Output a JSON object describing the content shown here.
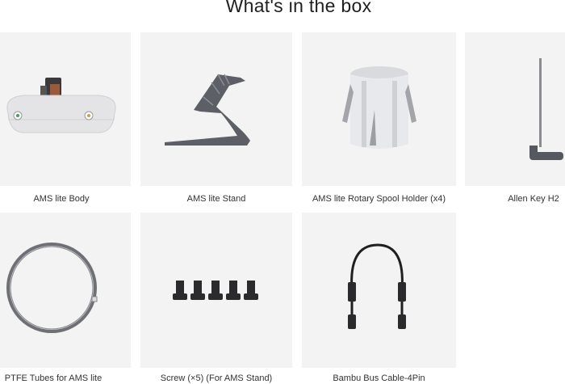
{
  "page": {
    "title": "What's in the box"
  },
  "items": [
    {
      "label": "AMS lite Body",
      "icon": "ams-lite-body-icon"
    },
    {
      "label": "AMS lite Stand",
      "icon": "ams-lite-stand-icon"
    },
    {
      "label": "AMS lite Rotary Spool Holder (x4)",
      "icon": "spool-holder-icon"
    },
    {
      "label": "Allen Key H2",
      "icon": "allen-key-icon"
    },
    {
      "label": "PTFE Tubes for AMS lite",
      "icon": "ptfe-tube-icon"
    },
    {
      "label": "Screw (×5) (For AMS Stand)",
      "icon": "screw-icon"
    },
    {
      "label": "Bambu Bus Cable-4Pin",
      "icon": "bus-cable-icon"
    }
  ]
}
